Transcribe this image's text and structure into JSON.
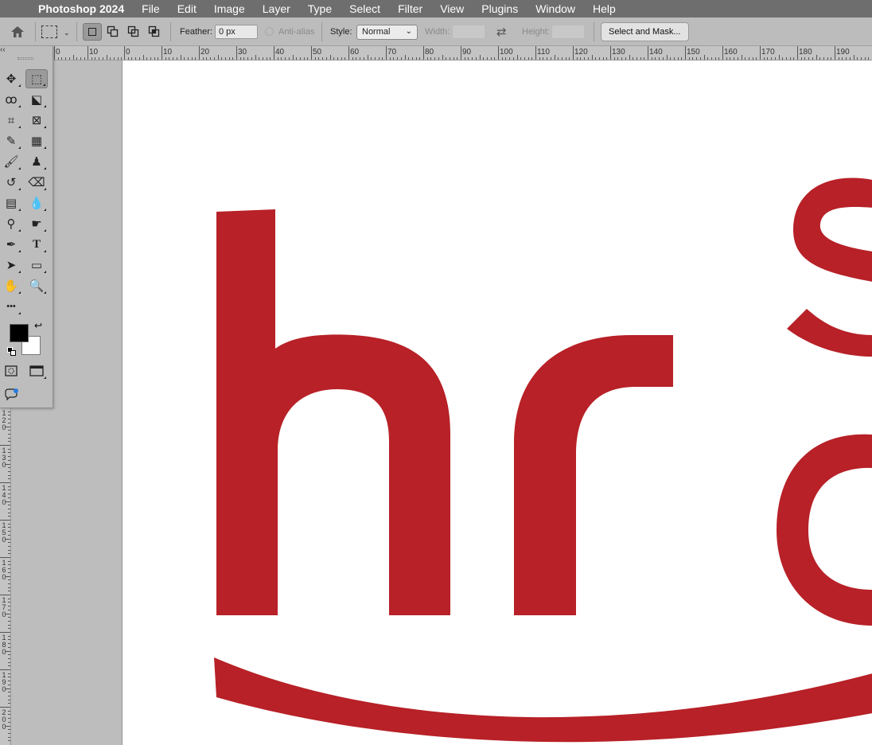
{
  "menubar": {
    "app_name": "Photoshop 2024",
    "items": [
      "File",
      "Edit",
      "Image",
      "Layer",
      "Type",
      "Select",
      "Filter",
      "View",
      "Plugins",
      "Window",
      "Help"
    ]
  },
  "options": {
    "feather_label": "Feather:",
    "feather_value": "0 px",
    "antialias_label": "Anti-alias",
    "style_label": "Style:",
    "style_value": "Normal",
    "width_label": "Width:",
    "height_label": "Height:",
    "select_mask_label": "Select and Mask..."
  },
  "ruler": {
    "h_labels": [
      "0",
      "10",
      "0",
      "10",
      "20",
      "30",
      "40",
      "50",
      "60",
      "70",
      "80",
      "90",
      "100",
      "110",
      "120",
      "130",
      "140",
      "150",
      "160",
      "170",
      "180",
      "190"
    ],
    "v_labels": [
      "120",
      "130",
      "140",
      "150",
      "160",
      "170",
      "180",
      "190",
      "200"
    ]
  },
  "tools": [
    {
      "name": "move-tool",
      "glyph": "✥",
      "col": 0,
      "row": 0
    },
    {
      "name": "rectangular-marquee-tool",
      "glyph": "⬚",
      "col": 1,
      "row": 0,
      "active": true
    },
    {
      "name": "lasso-tool",
      "glyph": "ꝏ",
      "col": 0,
      "row": 1
    },
    {
      "name": "object-selection-tool",
      "glyph": "⬕",
      "col": 1,
      "row": 1
    },
    {
      "name": "crop-tool",
      "glyph": "⌗",
      "col": 0,
      "row": 2
    },
    {
      "name": "frame-tool",
      "glyph": "⊠",
      "col": 1,
      "row": 2
    },
    {
      "name": "eyedropper-tool",
      "glyph": "✎",
      "col": 0,
      "row": 3
    },
    {
      "name": "spot-healing-tool",
      "glyph": "▦",
      "col": 1,
      "row": 3
    },
    {
      "name": "brush-tool",
      "glyph": "🖌",
      "col": 0,
      "row": 4
    },
    {
      "name": "clone-stamp-tool",
      "glyph": "♟",
      "col": 1,
      "row": 4
    },
    {
      "name": "history-brush-tool",
      "glyph": "↺",
      "col": 0,
      "row": 5
    },
    {
      "name": "eraser-tool",
      "glyph": "⌫",
      "col": 1,
      "row": 5
    },
    {
      "name": "gradient-tool",
      "glyph": "▤",
      "col": 0,
      "row": 6
    },
    {
      "name": "blur-tool",
      "glyph": "💧",
      "col": 1,
      "row": 6
    },
    {
      "name": "dodge-tool",
      "glyph": "⚲",
      "col": 0,
      "row": 7
    },
    {
      "name": "smudge-tool",
      "glyph": "☛",
      "col": 1,
      "row": 7
    },
    {
      "name": "pen-tool",
      "glyph": "✒",
      "col": 0,
      "row": 8
    },
    {
      "name": "type-tool",
      "glyph": "T",
      "col": 1,
      "row": 8
    },
    {
      "name": "path-selection-tool",
      "glyph": "➤",
      "col": 0,
      "row": 9
    },
    {
      "name": "rectangle-tool",
      "glyph": "▭",
      "col": 1,
      "row": 9
    },
    {
      "name": "hand-tool",
      "glyph": "✋",
      "col": 0,
      "row": 10
    },
    {
      "name": "zoom-tool",
      "glyph": "🔍",
      "col": 1,
      "row": 10
    },
    {
      "name": "edit-toolbar",
      "glyph": "•••",
      "col": 0,
      "row": 11
    }
  ],
  "colors": {
    "foreground": "#000000",
    "background": "#ffffff",
    "logo_red": "#b72127"
  }
}
